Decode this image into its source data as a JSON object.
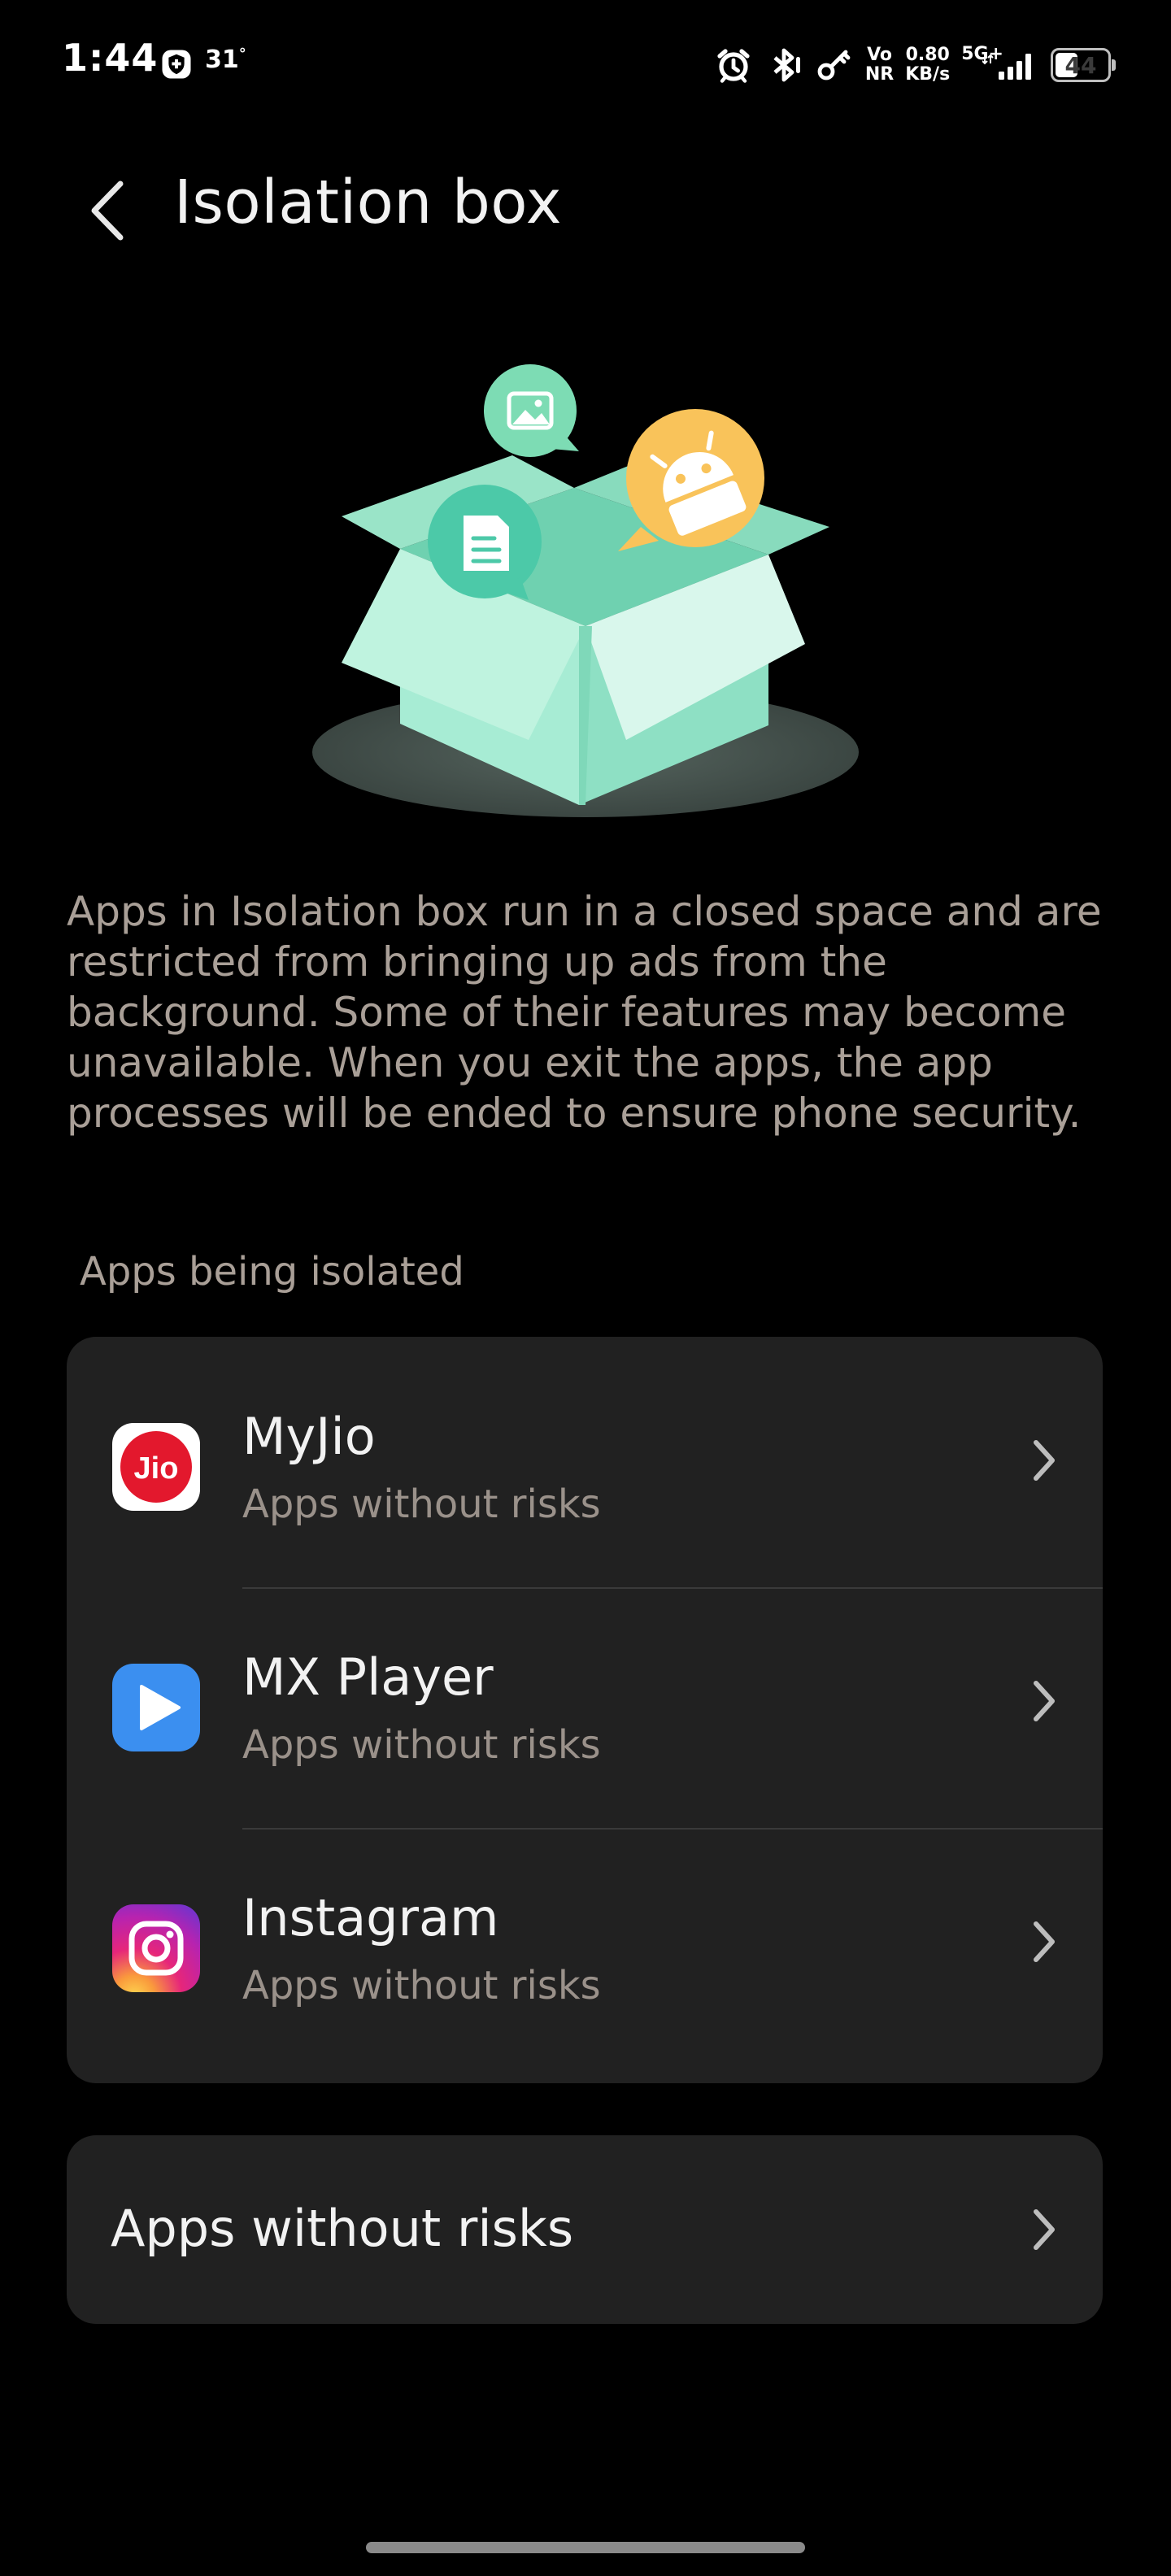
{
  "status_bar": {
    "time": "1:44",
    "temperature": "31",
    "temperature_unit": "°",
    "volte_top": "Vo",
    "volte_bottom": "NR",
    "speed_value": "0.80",
    "speed_unit": "KB/s",
    "network": "5G+",
    "battery": "44",
    "battery_level_percent": 44,
    "icons": [
      "shield-icon",
      "alarm-icon",
      "bluetooth-icon",
      "vpn-key-icon",
      "signal-icon",
      "battery-icon"
    ]
  },
  "header": {
    "title": "Isolation box",
    "back_icon": "chevron-left-icon"
  },
  "illustration": {
    "icons": [
      "open-box-icon",
      "image-bubble-icon",
      "document-bubble-icon",
      "android-bubble-icon"
    ],
    "colors": {
      "box_light": "#a7ecd4",
      "box_mid": "#8ee0c4",
      "box_dark": "#6fd1b0",
      "bubble_green": "#7ddcb4",
      "bubble_teal": "#4cc9a8",
      "bubble_orange": "#f9c35a",
      "shadow": "#3f4b46"
    }
  },
  "description": "Apps in Isolation box run in a closed space and are restricted from bringing up ads from the background. Some of their features may become unavailable. When you exit the apps, the app processes will be ended to ensure phone security.",
  "section": {
    "title": "Apps being isolated"
  },
  "apps": [
    {
      "name": "MyJio",
      "subtitle": "Apps without risks",
      "icon": "myjio-app-icon",
      "icon_text": "Jio",
      "icon_color": "#e3182d"
    },
    {
      "name": "MX Player",
      "subtitle": "Apps without risks",
      "icon": "mx-player-app-icon",
      "icon_color": "#3b8ff0"
    },
    {
      "name": "Instagram",
      "subtitle": "Apps without risks",
      "icon": "instagram-app-icon",
      "icon_color": "#dd2a7b"
    }
  ],
  "risk_item": {
    "label": "Apps without risks",
    "icon": "chevron-right-icon"
  },
  "colors": {
    "background": "#000000",
    "card": "#212121",
    "primary_text": "#f2f2f2",
    "secondary_text": "#a99f97"
  }
}
